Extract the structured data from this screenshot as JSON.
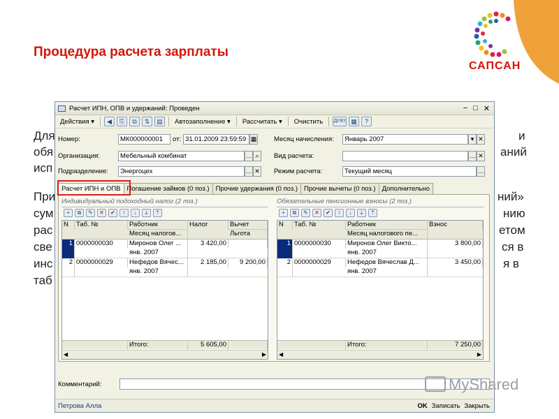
{
  "slide": {
    "title": "Процедура расчета зарплаты",
    "logo_text": "САПСАН",
    "watermark": "MyShared",
    "bg_text": {
      "l1_left": "Для",
      "l1_right": "и",
      "l2_left": "обя",
      "l2_right": "аний",
      "l3_left": "исп",
      "l4_left": "При",
      "l4_right": "ний»",
      "l5_left": "сум",
      "l5_right": "нию",
      "l6_left": "рас",
      "l6_right": "етом",
      "l7_left": "све",
      "l7_right": "ся в",
      "l8_left": "инс",
      "l8_right": "я в",
      "l9_left": "таб"
    }
  },
  "window": {
    "title": "Расчет ИПН, ОПВ и удержаний: Проведен",
    "controls": [
      "−",
      "□",
      "✕"
    ],
    "toolbar": {
      "actions": "Действия ▾",
      "autofill": "Автозаполнение ▾",
      "calculate": "Рассчитать ▾",
      "clear": "Очистить",
      "icons": [
        "◀",
        "⎘",
        "⧉",
        "⇅",
        "▤",
        "Дт/Кт",
        "▦",
        "?"
      ]
    },
    "form": {
      "number_label": "Номер:",
      "number_value": "МК000000001",
      "from_label": "от:",
      "from_value": "31.01.2009 23:59:59",
      "org_label": "Организация:",
      "org_value": "Мебельный комбинат",
      "dept_label": "Подразделение:",
      "dept_value": "Энергоцех",
      "month_label": "Месяц начисления:",
      "month_value": "Январь 2007",
      "calc_type_label": "Вид расчета:",
      "calc_type_value": "",
      "mode_label": "Режим расчета:",
      "mode_value": "Текущий месяц"
    },
    "tabs": [
      {
        "label": "Расчет ИПН и ОПВ"
      },
      {
        "label": "Погашение займов (0 поз.)"
      },
      {
        "label": "Прочие удержания (0 поз.)"
      },
      {
        "label": "Прочие вычеты (0 поз.)"
      },
      {
        "label": "Дополнительно"
      }
    ],
    "left": {
      "title": "Индивидуальный подоходный налог (2 поз.)",
      "headers": {
        "n": "N",
        "tab": "Таб. №",
        "worker": "Работник",
        "worker2": "Месяц налогов...",
        "tax": "Налог",
        "deduct": "Вычет",
        "deduct2": "Льгота"
      },
      "rows": [
        {
          "n": "1",
          "tab": "0000000030",
          "worker": "Миронов Олег ...",
          "month": "янв. 2007",
          "tax": "3 420,00",
          "deduct": ""
        },
        {
          "n": "2",
          "tab": "0000000029",
          "worker": "Нефедов Вячес...",
          "month": "янв. 2007",
          "tax": "2 185,00",
          "deduct": "9 200,00"
        }
      ],
      "total_label": "Итого:",
      "total_value": "5 605,00"
    },
    "right": {
      "title": "Обязательные пенсионные взносы (2 поз.)",
      "headers": {
        "n": "N",
        "tab": "Таб. №",
        "worker": "Работник",
        "worker2": "Месяц налогового пе...",
        "contrib": "Взнос"
      },
      "rows": [
        {
          "n": "1",
          "tab": "0000000030",
          "worker": "Миронов Олег Викто...",
          "month": "янв. 2007",
          "contrib": "3 800,00"
        },
        {
          "n": "2",
          "tab": "0000000029",
          "worker": "Нефедов Вячеслав Д...",
          "month": "янв. 2007",
          "contrib": "3 450,00"
        }
      ],
      "total_label": "Итого:",
      "total_value": "7 250,00"
    },
    "comment_label": "Комментарий:",
    "comment_value": "",
    "status_user": "Петрова Алла",
    "buttons": {
      "ok": "OK",
      "save": "Записать",
      "close": "Закрыть"
    }
  }
}
